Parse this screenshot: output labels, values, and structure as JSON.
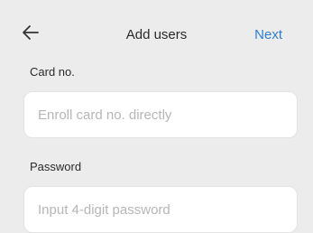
{
  "header": {
    "back_icon": "arrow-left-icon",
    "title": "Add users",
    "next_label": "Next",
    "accent_color": "#2f7fd1"
  },
  "card": {
    "label": "Card no.",
    "value": "",
    "placeholder": "Enroll card no. directly"
  },
  "password": {
    "label": "Password",
    "value": "",
    "placeholder": "Input 4-digit password"
  }
}
